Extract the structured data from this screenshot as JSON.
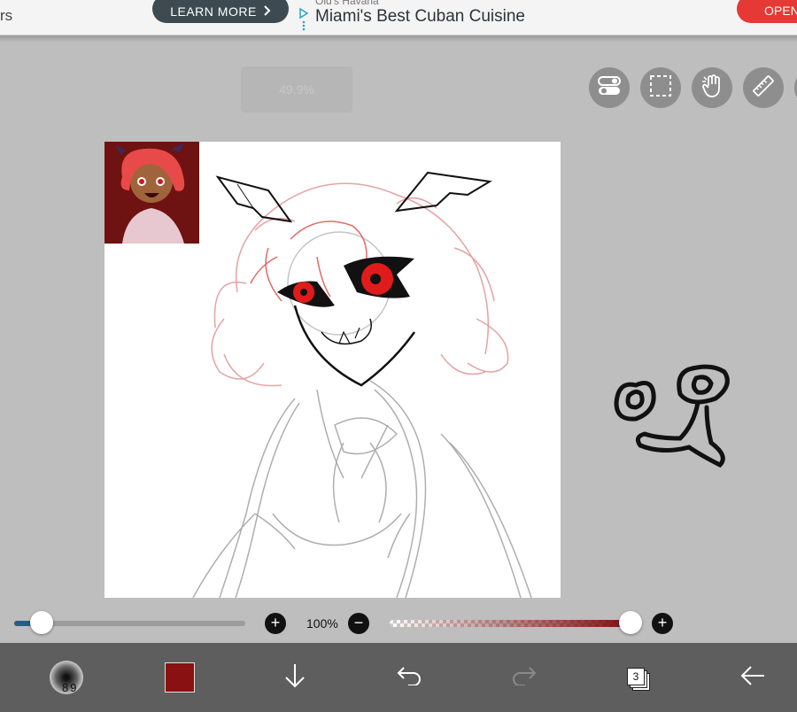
{
  "ad": {
    "left_fragment": "rs",
    "learn_more": "LEARN MORE",
    "advertiser": "Old's Havana",
    "headline": "Miami's Best Cuban Cuisine",
    "open": "OPEN"
  },
  "top_toolbar": {
    "zoom_indicator": "49.9%",
    "tools": [
      "toggle-icon",
      "selection-icon",
      "hand-icon",
      "ruler-icon"
    ]
  },
  "sliders": {
    "brush_size_level": 0.12,
    "zoom_label": "100%",
    "opacity_level": 1.0
  },
  "bottom_bar": {
    "brush_size": "89",
    "color": "#8a1111",
    "layer_count": "3",
    "icons": [
      "brush-preview-icon",
      "color-swatch",
      "download-icon",
      "undo-icon",
      "redo-icon",
      "layers-icon",
      "back-arrow-icon"
    ]
  },
  "colors": {
    "background": "#bebebe",
    "toolbar_button": "#8e8e8e",
    "bottom_bar": "#5e5e5e",
    "accent_blue": "#2c5a8a",
    "open_button": "#e53935",
    "learn_more_button": "#3e4a52"
  }
}
